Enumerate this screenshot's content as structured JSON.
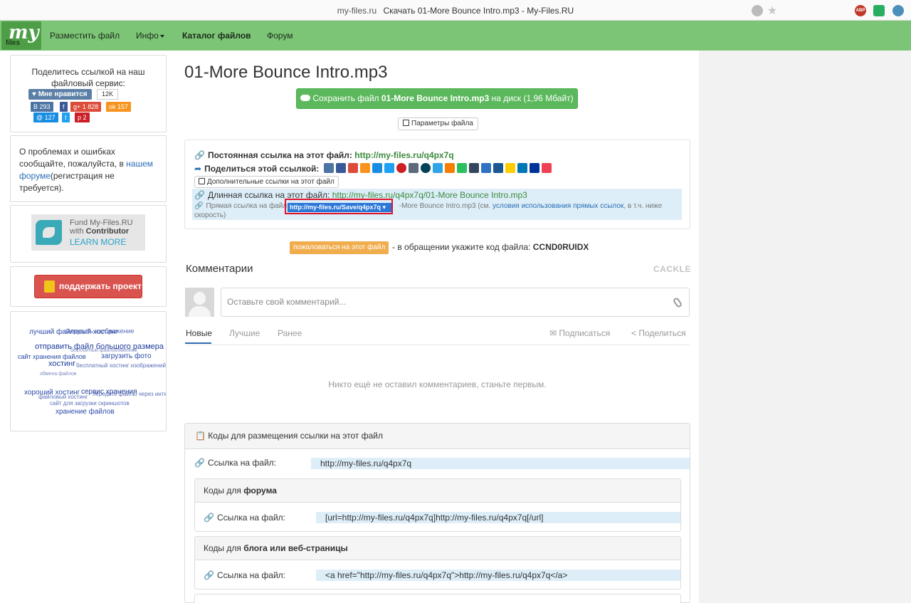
{
  "browser": {
    "domain": "my-files.ru",
    "title": "Скачать 01-More Bounce Intro.mp3 - My-Files.RU"
  },
  "nav": {
    "logo_my": "my",
    "logo_files": "files",
    "upload": "Разместить файл",
    "info": "Инфо",
    "catalog": "Каталог файлов",
    "forum": "Форум"
  },
  "sidebar": {
    "share_title": "Поделитесь ссылкой на наш файловый сервис:",
    "like_label": "Мне нравится",
    "like_count": "12K",
    "social": [
      {
        "label": "B 293",
        "color": "#4c75a3"
      },
      {
        "label": "f",
        "color": "#3b5998"
      },
      {
        "label": "g+ 1 828",
        "color": "#dd4b39"
      },
      {
        "label": "ok 157",
        "color": "#f7931e"
      },
      {
        "label": "@ 127",
        "color": "#168de2"
      },
      {
        "label": "t",
        "color": "#1da1f2"
      },
      {
        "label": "p 2",
        "color": "#cb2027"
      }
    ],
    "problems_text_1": "О проблемах и ошибках сообщайте, пожалуйста, в ",
    "problems_link": "нашем форуме",
    "problems_text_2": "(регистрация не требуется).",
    "fund_line1": "Fund My-Files.RU",
    "fund_with": "with",
    "fund_contributor": "Contributor",
    "fund_learn": "LEARN MORE",
    "support_label": "поддержать проект",
    "tags": [
      "лучший файловый хостинг",
      "загрузить изображение",
      "отправить файл большого размера",
      "сайт хранения файлов",
      "загрузить фото",
      "бесплатный файлообменник",
      "хостинг",
      "бесплатный хостинг изображений",
      "обмена файлов",
      "хороший хостинг",
      "сервис хранения",
      "файловый хостинг",
      "передать файлы через интернет",
      "сайт для загрузки скриншотов",
      "хранение файлов"
    ]
  },
  "main": {
    "file_title": "01-More Bounce Intro.mp3",
    "save_prefix": "Сохранить файл ",
    "save_filename": "01-More Bounce Intro.mp3",
    "save_suffix": " на диск (1,96 Мбайт)",
    "params_label": "Параметры файла",
    "permanent_label": "Постоянная ссылка на этот файл:",
    "permanent_url": "http://my-files.ru/q4px7q",
    "share_label": "Поделиться этой ссылкой:",
    "share_icons": [
      {
        "name": "vk",
        "color": "#4c75a3"
      },
      {
        "name": "facebook",
        "color": "#3b5998"
      },
      {
        "name": "google-plus",
        "color": "#dd4b39"
      },
      {
        "name": "odnoklassniki",
        "color": "#f7931e"
      },
      {
        "name": "mailru",
        "color": "#168de2"
      },
      {
        "name": "twitter",
        "color": "#1da1f2"
      },
      {
        "name": "pinterest",
        "color": "#cb2027"
      },
      {
        "name": "link",
        "color": "#5a6b7d"
      },
      {
        "name": "livejournal",
        "color": "#004359"
      },
      {
        "name": "surfingbird",
        "color": "#2fa4e7"
      },
      {
        "name": "blogger",
        "color": "#f57d00"
      },
      {
        "name": "evernote",
        "color": "#2dbe60"
      },
      {
        "name": "tumblr",
        "color": "#35465c"
      },
      {
        "name": "friendfeed",
        "color": "#2f72c4"
      },
      {
        "name": "digg",
        "color": "#1b5791"
      },
      {
        "name": "yandex",
        "color": "#ffcc00"
      },
      {
        "name": "linkedin",
        "color": "#0077b5"
      },
      {
        "name": "myspace",
        "color": "#003399"
      },
      {
        "name": "pocket",
        "color": "#ef4056"
      }
    ],
    "extra_links_btn": "Дополнительные ссылки на этот файл",
    "long_label": "Длинная ссылка на этот файл:",
    "long_url": "http://my-files.ru/q4px7q/01-More Bounce Intro.mp3",
    "direct_label": "Прямая ссылка на файл:",
    "direct_url_selected": "http://my-files.ru/Save/q4px7q",
    "direct_rest": "-More Bounce Intro.mp3",
    "direct_see": " (см. ",
    "direct_terms_link": "условия использования прямых ссылок",
    "direct_after": ", в т.ч. ниже скорость)",
    "complain_btn": "пожаловаться на этот файл",
    "complain_text": " - в обращении укажите код файла: ",
    "file_code": "CCND0RUIDX"
  },
  "comments": {
    "title": "Комментарии",
    "provider": "CACKLE",
    "placeholder": "Оставьте свой комментарий...",
    "tabs": [
      "Новые",
      "Лучшие",
      "Ранее"
    ],
    "subscribe": "Подписаться",
    "share": "Поделиться",
    "empty": "Никто ещё не оставил комментариев, станьте первым."
  },
  "codes": {
    "header": "Коды для размещения ссылки на этот файл",
    "link_label": "Ссылка на файл:",
    "link_value": "http://my-files.ru/q4px7q",
    "forum_head_prefix": "Коды для ",
    "forum_head_bold": "форума",
    "forum_value": "[url=http://my-files.ru/q4px7q]http://my-files.ru/q4px7q[/url]",
    "blog_head_prefix": "Коды для ",
    "blog_head_bold": "блога или веб-страницы",
    "blog_value": "<a href=\"http://my-files.ru/q4px7q\">http://my-files.ru/q4px7q</a>"
  }
}
